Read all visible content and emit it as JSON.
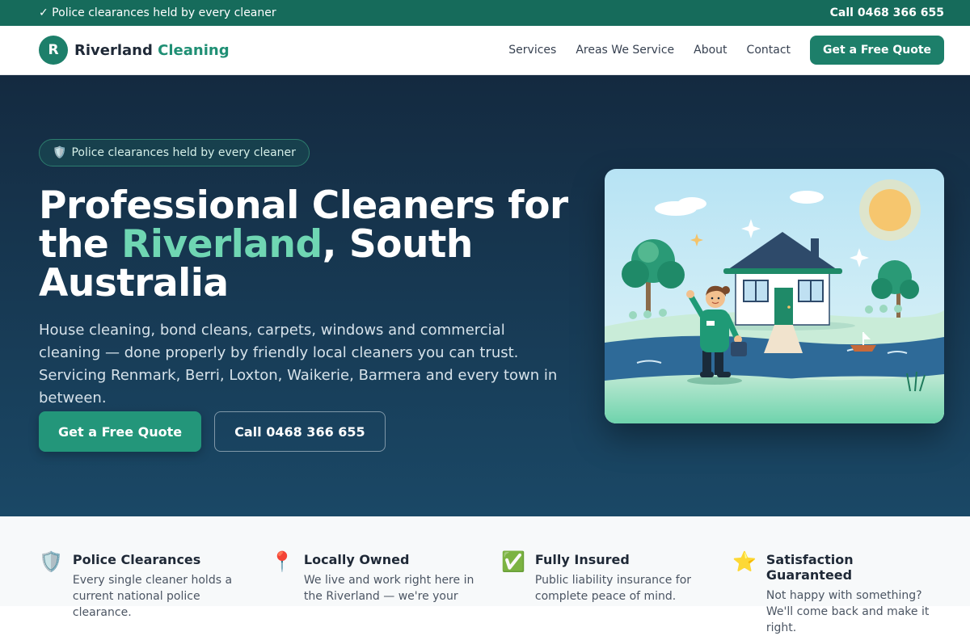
{
  "topbar": {
    "tagline": "✓ Police clearances held by every cleaner",
    "phone": "Call 0468 366 655"
  },
  "brand": {
    "initial": "R",
    "name": "Riverland",
    "accent": "Cleaning"
  },
  "nav": {
    "items": [
      {
        "label": "Services"
      },
      {
        "label": "Areas We Service"
      },
      {
        "label": "About"
      },
      {
        "label": "Contact"
      }
    ],
    "cta": "Get a Free Quote"
  },
  "hero": {
    "badge_icon": "🛡️",
    "badge": "Police clearances held by every cleaner",
    "title_a": "Professional Cleaners for the ",
    "title_hl": "Riverland",
    "title_b": ", South Australia",
    "subtitle": "House cleaning, bond cleans, carpets, windows and commercial cleaning — done properly by friendly local cleaners you can trust. Servicing Renmark, Berri, Loxton, Waikerie, Barmera and every town in between.",
    "primary_cta": "Get a Free Quote",
    "secondary_cta": "Call 0468 366 655"
  },
  "features": [
    {
      "icon": "🛡️",
      "title": "Police Clearances",
      "text": "Every single cleaner holds a current national police clearance."
    },
    {
      "icon": "📍",
      "title": "Locally Owned",
      "text": "We live and work right here in the Riverland — we're your"
    },
    {
      "icon": "✅",
      "title": "Fully Insured",
      "text": "Public liability insurance for complete peace of mind."
    },
    {
      "icon": "⭐",
      "title": "Satisfaction Guaranteed",
      "text": "Not happy with something? We'll come back and make it right."
    }
  ],
  "colors": {
    "brand": "#1d7f6a",
    "accent": "#6fd6b3",
    "hero_top": "#142a40",
    "hero_bottom": "#1a4866"
  }
}
